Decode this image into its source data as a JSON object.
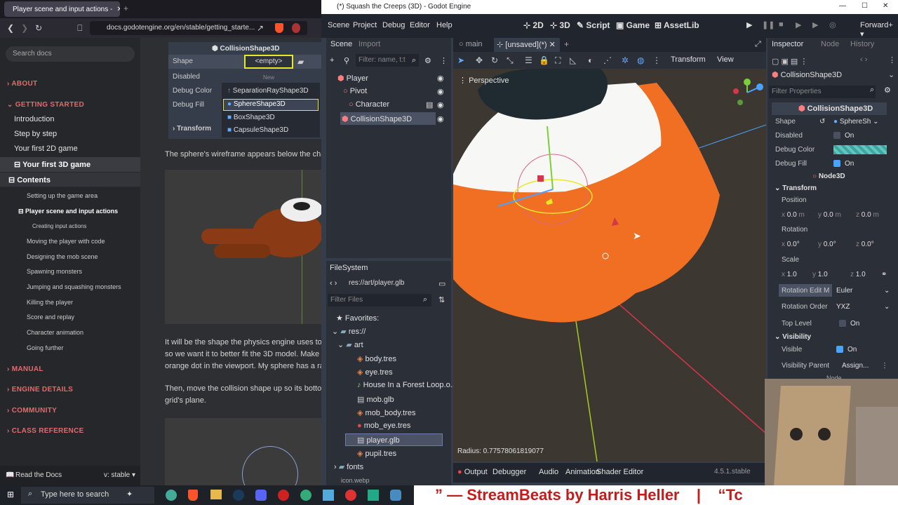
{
  "browser": {
    "tab_title": "Player scene and input actions -",
    "url": "docs.godotengine.org/en/stable/getting_starte...",
    "search_placeholder": "Search docs",
    "sections": [
      "ABOUT",
      "GETTING STARTED",
      "MANUAL",
      "ENGINE DETAILS",
      "COMMUNITY",
      "CLASS REFERENCE"
    ],
    "getting_started_items": [
      "Introduction",
      "Step by step",
      "Your first 2D game",
      "Your first 3D game"
    ],
    "contents_label": "Contents",
    "sub_items": [
      "Setting up the game area",
      "Player scene and input actions",
      "Creating input actions",
      "Moving the player with code",
      "Designing the mob scene",
      "Spawning monsters",
      "Jumping and squashing monsters",
      "Killing the player",
      "Score and replay",
      "Character animation",
      "Going further"
    ],
    "read_the_docs": "Read the Docs",
    "version": "v: stable",
    "para1": "The sphere's wireframe appears below the char",
    "para2": [
      "It will be the shape the physics engine uses to c",
      "so we want it to better fit the 3D model. Make i",
      "orange dot in the viewport. My sphere has a ra"
    ],
    "para3": [
      "Then, move the collision shape up so its botton",
      "grid's plane."
    ],
    "embedded_inspector": {
      "title": "CollisionShape3D",
      "labels": [
        "Shape",
        "Disabled",
        "Debug Color",
        "Debug Fill"
      ],
      "empty": "<empty>",
      "new_label": "New",
      "options": [
        "SeparationRayShape3D",
        "SphereShape3D",
        "BoxShape3D",
        "CapsuleShape3D"
      ],
      "transform": "Transform"
    }
  },
  "godot": {
    "title": "(*) Squash the Creeps (3D) - Godot Engine",
    "menus": [
      "Scene",
      "Project",
      "Debug",
      "Editor",
      "Help"
    ],
    "workspaces": [
      "2D",
      "3D",
      "Script",
      "Game",
      "AssetLib"
    ],
    "renderer": "Forward+",
    "scene_tabs": [
      "Scene",
      "Import"
    ],
    "filter_nodes_placeholder": "Filter: name, t:t",
    "tree": [
      "Player",
      "Pivot",
      "Character",
      "CollisionShape3D"
    ],
    "editor_tabs": [
      "main",
      "[unsaved](*)"
    ],
    "toolbar": [
      "Transform",
      "View"
    ],
    "perspective": "Perspective",
    "radius_readout": "Radius: 0.77578061819077",
    "bottom_tabs": [
      "Output",
      "Debugger",
      "Audio",
      "Animation",
      "Shader Editor"
    ],
    "version": "4.5.1.stable",
    "filesystem": {
      "title": "FileSystem",
      "path": "res://art/player.glb",
      "filter_placeholder": "Filter Files",
      "favorites": "Favorites:",
      "root": "res://",
      "folder": "art",
      "files": [
        "body.tres",
        "eye.tres",
        "House In a Forest Loop.o...",
        "mob.glb",
        "mob_body.tres",
        "mob_eye.tres",
        "player.glb",
        "pupil.tres"
      ],
      "fonts": "fonts",
      "cut": "icon.webp"
    },
    "inspector": {
      "tabs": [
        "Inspector",
        "Node",
        "History"
      ],
      "node": "CollisionShape3D",
      "filter_placeholder": "Filter Properties",
      "section": "CollisionShape3D",
      "shape_label": "Shape",
      "shape_value": "SphereSh",
      "disabled_label": "Disabled",
      "on": "On",
      "debug_color_label": "Debug Color",
      "debug_fill_label": "Debug Fill",
      "node3d": "Node3D",
      "transform": "Transform",
      "position": "Position",
      "rotation": "Rotation",
      "scale": "Scale",
      "pos_vals": [
        "0.0",
        "0.0",
        "0.0"
      ],
      "rot_vals": [
        "0.0",
        "0.0",
        "0.0"
      ],
      "scale_vals": [
        "1.0",
        "1.0",
        "1.0"
      ],
      "m": "m",
      "rot_edit": "Rotation Edit M",
      "rot_edit_val": "Euler",
      "rot_order": "Rotation Order",
      "rot_order_val": "YXZ",
      "top_level": "Top Level",
      "visibility": "Visibility",
      "visible": "Visible",
      "vis_parent": "Visibility Parent",
      "assign": "Assign...",
      "node_cut": "Node"
    }
  },
  "taskbar": {
    "search": "Type here to search",
    "banner": "” — StreamBeats by Harris Heller    |    “Tc"
  }
}
